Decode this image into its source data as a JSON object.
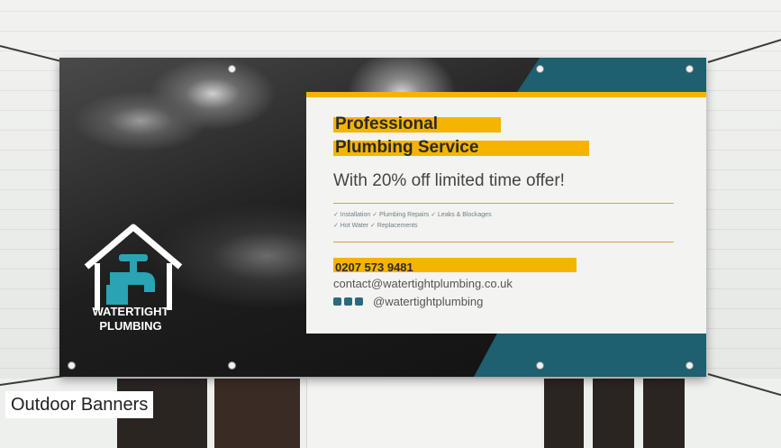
{
  "banner": {
    "headline_line1": "Professional",
    "headline_line2": "Plumbing Service",
    "subheadline": "With 20% off limited time offer!",
    "services_row1": "✓ Installation    ✓ Plumbing Repairs    ✓ Leaks & Blockages",
    "services_row2": "✓ Hot Water    ✓ Replacements",
    "phone": "0207 573 9481",
    "email": "contact@watertightplumbing.co.uk",
    "social_handle": "@watertightplumbing",
    "brand_line1": "WATERTIGHT",
    "brand_line2": "PLUMBING"
  },
  "caption": "Outdoor Banners",
  "colors": {
    "accent_yellow": "#f5b400",
    "brand_teal": "#1e5f70",
    "panel_bg": "#f3f3f1"
  },
  "icons": [
    "house-tap-logo-icon",
    "facebook-icon",
    "twitter-icon",
    "instagram-icon"
  ]
}
